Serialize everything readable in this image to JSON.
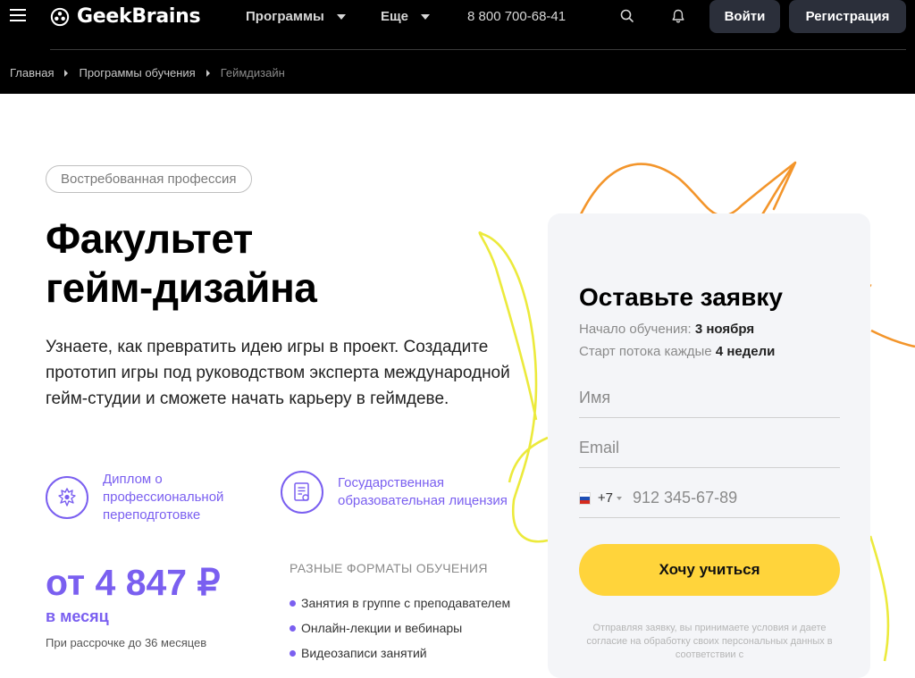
{
  "header": {
    "logo_text": "GeekBrains",
    "nav": [
      {
        "label": "Программы"
      },
      {
        "label": "Еще"
      }
    ],
    "phone": "8 800 700-68-41",
    "login_label": "Войти",
    "register_label": "Регистрация",
    "icons": [
      "menu-icon",
      "search-icon",
      "bell-icon",
      "chevron-down-icon"
    ]
  },
  "breadcrumb": [
    "Главная",
    "Программы обучения",
    "Геймдизайн"
  ],
  "hero": {
    "badge": "Востребованная профессия",
    "title_line1": "Факультет",
    "title_line2": "гейм-дизайна",
    "description": "Узнаете, как превратить идею игры в проект. Создадите прототип игры под руководством эксперта международной гейм-студии и сможете начать карьеру в геймдеве."
  },
  "features": [
    {
      "icon": "emblem-icon",
      "line1": "Диплом о",
      "line2": "профессиональной",
      "line3": "переподготовке"
    },
    {
      "icon": "license-icon",
      "line1": "Государственная",
      "line2": "образовательная лицензия"
    }
  ],
  "pricing": {
    "price": "от 4 847 ₽",
    "period": "в месяц",
    "installment": "При рассрочке до 36 месяцев"
  },
  "formats": {
    "title": "РАЗНЫЕ ФОРМАТЫ ОБУЧЕНИЯ",
    "items": [
      "Занятия в группе с преподавателем",
      "Онлайн-лекции и вебинары",
      "Видеозаписи занятий"
    ]
  },
  "form": {
    "title": "Оставьте заявку",
    "start_label": "Начало обучения:",
    "start_value": "3 ноября",
    "stream_label": "Старт потока каждые",
    "stream_value": "4 недели",
    "name_placeholder": "Имя",
    "email_placeholder": "Email",
    "phone_code": "+7",
    "phone_placeholder": "912 345-67-89",
    "submit_label": "Хочу учиться",
    "legal_text": "Отправляя заявку, вы принимаете условия и даете согласие на обработку своих персональных данных в соответствии с"
  },
  "colors": {
    "accent": "#7a5ff0",
    "cta": "#ffd43b",
    "header_bg": "#000000",
    "form_bg": "#f4f5f8"
  }
}
